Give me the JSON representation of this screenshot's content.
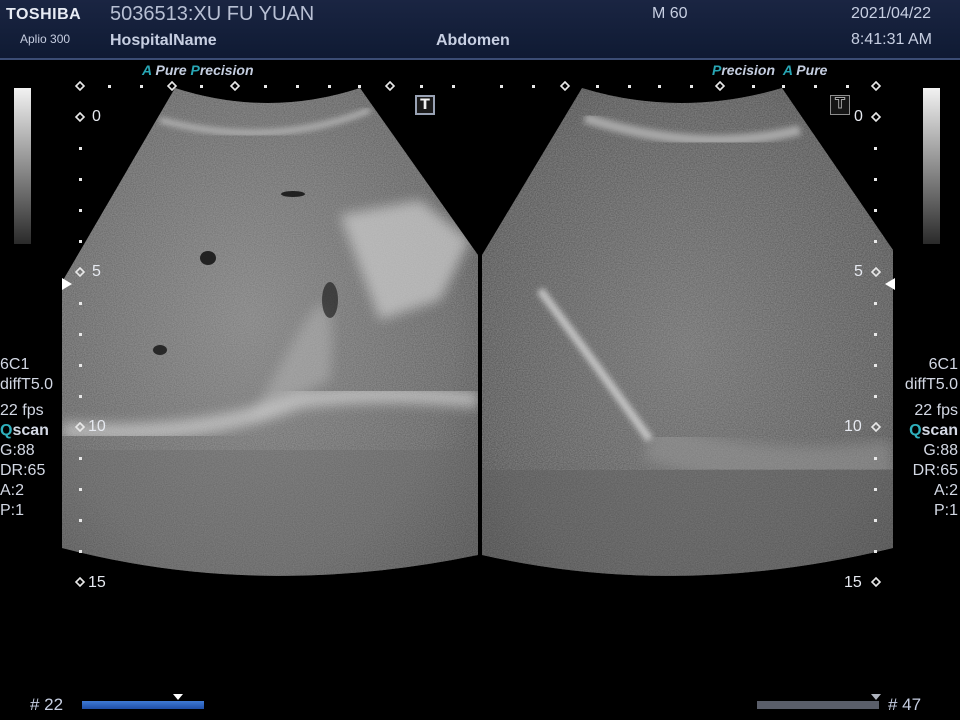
{
  "header": {
    "brand": "TOSHIBA",
    "model": "Aplio 300",
    "patient": "5036513:XU FU YUAN",
    "hospital": "HospitalName",
    "exam": "Abdomen",
    "mi": "M 60",
    "date": "2021/04/22",
    "time": "8:41:31 AM"
  },
  "left_panel": {
    "tag_a": "A",
    "tag_pure": " Pure ",
    "tag_p": "P",
    "tag_precision": "recision",
    "marker": "T",
    "depth_labels": [
      "0",
      "5",
      "10",
      "15"
    ],
    "params": {
      "probe": "6C1",
      "mode": "diffT5.0",
      "fps": "22 fps",
      "q_letter": "Q",
      "q_rest": "scan",
      "gain": "G:88",
      "dr": "DR:65",
      "a": "A:2",
      "p": "P:1"
    },
    "frame": "# 22",
    "cine_position": 0.75
  },
  "right_panel": {
    "tag_p": "P",
    "tag_recision": "recision",
    "tag_a": "A",
    "tag_pure": " Pure",
    "marker": "T",
    "depth_labels": [
      "0",
      "5",
      "10",
      "15"
    ],
    "params": {
      "probe": "6C1",
      "mode": "diffT5.0",
      "fps": "22 fps",
      "q_letter": "Q",
      "q_rest": "scan",
      "gain": "G:88",
      "dr": "DR:65",
      "a": "A:2",
      "p": "P:1"
    },
    "frame": "# 47",
    "cine_position": 0.95
  },
  "colors": {
    "header_bg": "#16213d",
    "accent_teal": "#28a6b4",
    "cine_blue": "#2f63c0"
  }
}
